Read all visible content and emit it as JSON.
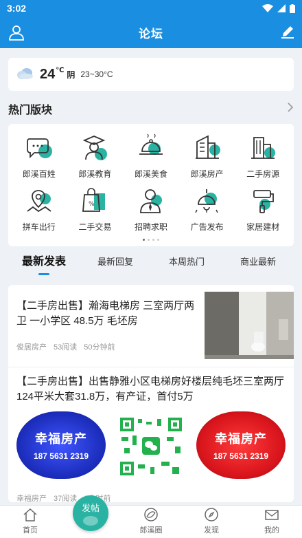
{
  "status": {
    "time": "3:02"
  },
  "header": {
    "title": "论坛",
    "left_icon": "user-icon",
    "right_icon": "edit-icon"
  },
  "weather": {
    "temp": "24",
    "unit": "℃",
    "condition": "阴",
    "range": "23~30°C",
    "icon": "cloud-icon"
  },
  "boards": {
    "title": "热门版块",
    "items": [
      {
        "label": "郎溪百姓",
        "icon": "chat-bubble-icon"
      },
      {
        "label": "郎溪教育",
        "icon": "graduate-icon"
      },
      {
        "label": "郎溪美食",
        "icon": "food-dish-icon"
      },
      {
        "label": "郎溪房产",
        "icon": "building-icon"
      },
      {
        "label": "二手房源",
        "icon": "house-icon"
      },
      {
        "label": "拼车出行",
        "icon": "map-pin-icon"
      },
      {
        "label": "二手交易",
        "icon": "shopping-bag-icon"
      },
      {
        "label": "招聘求职",
        "icon": "person-tie-icon"
      },
      {
        "label": "广告发布",
        "icon": "lamp-icon"
      },
      {
        "label": "家居建材",
        "icon": "paint-roller-icon"
      }
    ]
  },
  "tabs": [
    {
      "label": "最新发表",
      "active": true
    },
    {
      "label": "最新回复",
      "active": false
    },
    {
      "label": "本周热门",
      "active": false
    },
    {
      "label": "商业最新",
      "active": false
    }
  ],
  "posts": [
    {
      "title": "【二手房出售】瀚海电梯房 三室两厅两卫 一小学区 48.5万 毛坯房",
      "author": "俊居房产",
      "reads": "53阅读",
      "time": "50分钟前"
    },
    {
      "title": "【二手房出售】出售静雅小区电梯房好楼层纯毛坯三室两厅124平米大套31.8万，有产证，首付5万",
      "author": "幸福房产",
      "reads": "37阅读",
      "time": "1小时前",
      "ad_text": "幸福房产",
      "ad_phone": "187 5631 2319"
    }
  ],
  "nav": [
    {
      "label": "首页",
      "icon": "home-icon"
    },
    {
      "label": "",
      "icon": ""
    },
    {
      "label": "郎溪圈",
      "icon": "circle-icon"
    },
    {
      "label": "发现",
      "icon": "compass-icon"
    },
    {
      "label": "我的",
      "icon": "mail-icon"
    }
  ],
  "fab": {
    "label": "发帖"
  },
  "colors": {
    "primary": "#1a8ee0",
    "accent": "#2ab3a3",
    "ad_blue": "#2a3fd6",
    "ad_red": "#d8141c"
  }
}
